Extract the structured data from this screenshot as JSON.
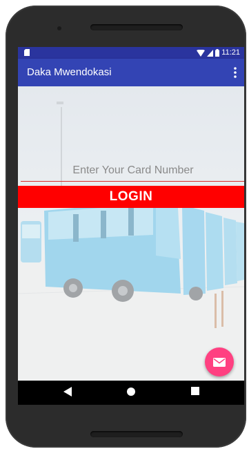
{
  "status_bar": {
    "time": "11:21",
    "icons": [
      "sd-card-icon",
      "wifi-icon",
      "signal-icon",
      "battery-icon"
    ]
  },
  "app_bar": {
    "title": "Daka Mwendokasi",
    "menu_icon": "overflow-menu-icon"
  },
  "login_form": {
    "card_number_placeholder": "Enter Your Card Number",
    "card_number_value": "",
    "login_label": "LOGIN"
  },
  "fab": {
    "icon": "mail-icon"
  },
  "nav_bar": {
    "icons": [
      "back-icon",
      "home-icon",
      "recents-icon"
    ]
  },
  "colors": {
    "status_bar": "#2a349e",
    "app_bar": "#3344b4",
    "login_button": "#ff0000",
    "fab": "#ff4081",
    "bus_body": "#5cb4dc"
  }
}
